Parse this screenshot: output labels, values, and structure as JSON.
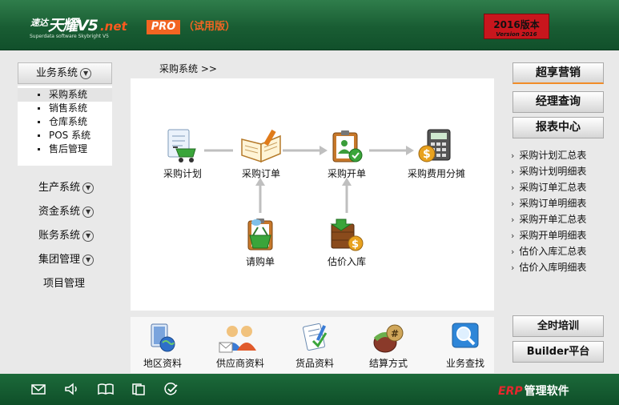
{
  "header": {
    "logo_cn": "速达",
    "logo_name": "天耀V5",
    "logo_suffix": ".net",
    "logo_tagline": "Superdata software Skybright V5",
    "edition": "PRO",
    "trial": "（试用版）",
    "version_line1": "2016版本",
    "version_line2": "Version 2016"
  },
  "left": {
    "active_group": "业务系统",
    "submenu": [
      "采购系统",
      "销售系统",
      "仓库系统",
      "POS 系统",
      "售后管理"
    ],
    "groups": [
      "生产系统",
      "资金系统",
      "账务系统",
      "集团管理"
    ],
    "project": "项目管理"
  },
  "breadcrumb": "采购系统  >>",
  "flow": {
    "plan": "采购计划",
    "order": "采购订单",
    "open": "采购开单",
    "cost": "采购费用分摊",
    "request": "请购单",
    "estimate": "估价入库"
  },
  "tools": [
    "地区资料",
    "供应商资料",
    "货品资料",
    "结算方式",
    "业务查找"
  ],
  "right": {
    "btn1": "超享营销",
    "btn2": "经理查询",
    "btn3": "报表中心",
    "reports": [
      "采购计划汇总表",
      "采购计划明细表",
      "采购订单汇总表",
      "采购订单明细表",
      "采购开单汇总表",
      "采购开单明细表",
      "估价入库汇总表",
      "估价入库明细表"
    ],
    "training": "全时培训",
    "builder": "Builder平台",
    "report_arrow": "›"
  },
  "footer": {
    "erp": "ERP",
    "erp_text": "管理软件"
  },
  "colors": {
    "header_green": "#195d33",
    "accent_orange": "#f26522",
    "version_red": "#c8161d"
  }
}
